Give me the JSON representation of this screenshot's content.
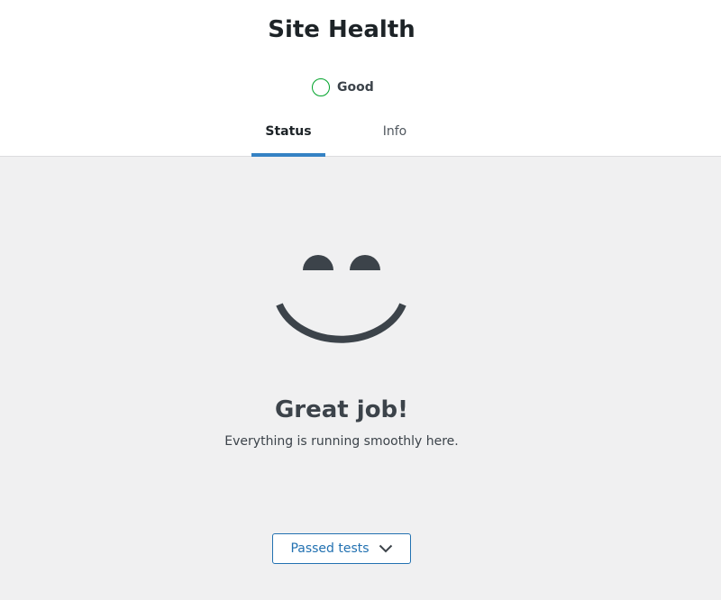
{
  "header": {
    "title": "Site Health",
    "status": {
      "label": "Good",
      "ring_color": "#00a32a",
      "icon": "status-ring-icon"
    },
    "tabs": [
      {
        "label": "Status",
        "active": true
      },
      {
        "label": "Info",
        "active": false
      }
    ],
    "accent_color": "#3582c4"
  },
  "main": {
    "illustration": "smiley-face-icon",
    "heading": "Great job!",
    "message": "Everything is running smoothly here.",
    "passed_tests_button": {
      "label": "Passed tests",
      "icon": "chevron-down-icon"
    }
  }
}
